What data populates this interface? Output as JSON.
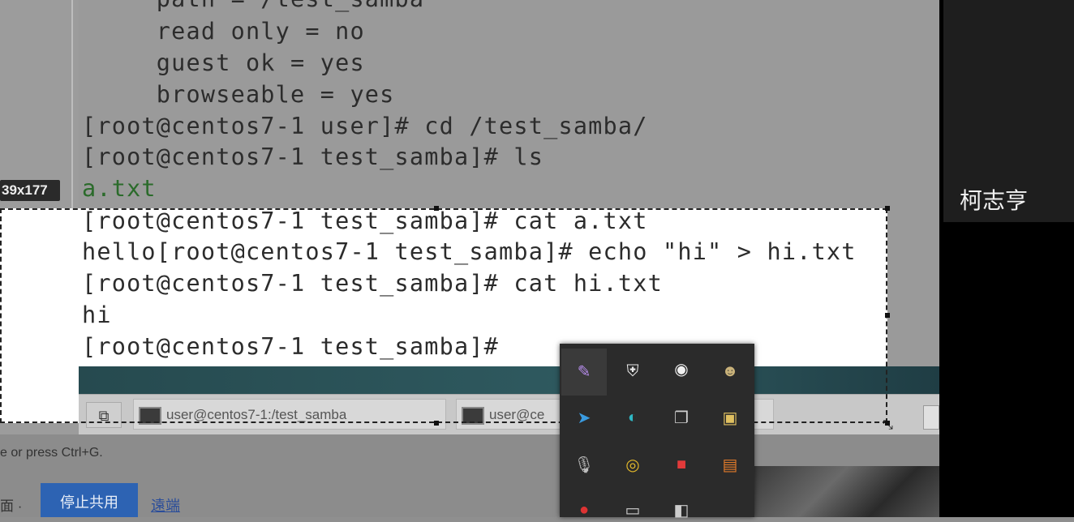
{
  "terminal": {
    "lines": [
      "     path = /test_samba",
      "     read only = no",
      "     guest ok = yes",
      "     browseable = yes",
      "[root@centos7-1 user]# cd /test_samba/",
      "[root@centos7-1 test_samba]# ls",
      "a.txt",
      "[root@centos7-1 test_samba]# cat a.txt",
      "hello[root@centos7-1 test_samba]# echo \"hi\" > hi.txt",
      "[root@centos7-1 test_samba]# cat hi.txt",
      "hi",
      "[root@centos7-1 test_samba]#"
    ]
  },
  "selection": {
    "size_label": "39x177"
  },
  "taskbar": {
    "desktop_icon": "show-desktop-icon",
    "items": [
      {
        "label": "user@centos7-1:/test_samba",
        "icon": "terminal-icon"
      },
      {
        "label": "user@ce",
        "icon": "terminal-icon"
      }
    ]
  },
  "host": {
    "hint": "e or press Ctrl+G.",
    "left_label": "面 ·",
    "stop_share_label": "停止共用",
    "link_label": "遠端"
  },
  "participant": {
    "name": "柯志亨"
  },
  "tray": {
    "icons": [
      "feather-icon",
      "shield-alert-icon",
      "record-icon",
      "character-icon",
      "telegram-icon",
      "edge-icon",
      "window-icon",
      "network-warning-icon",
      "microphone-icon",
      "chrome-icon",
      "youdao-icon",
      "scroll-icon",
      "antivirus-icon",
      "display-icon",
      "app-icon"
    ]
  }
}
